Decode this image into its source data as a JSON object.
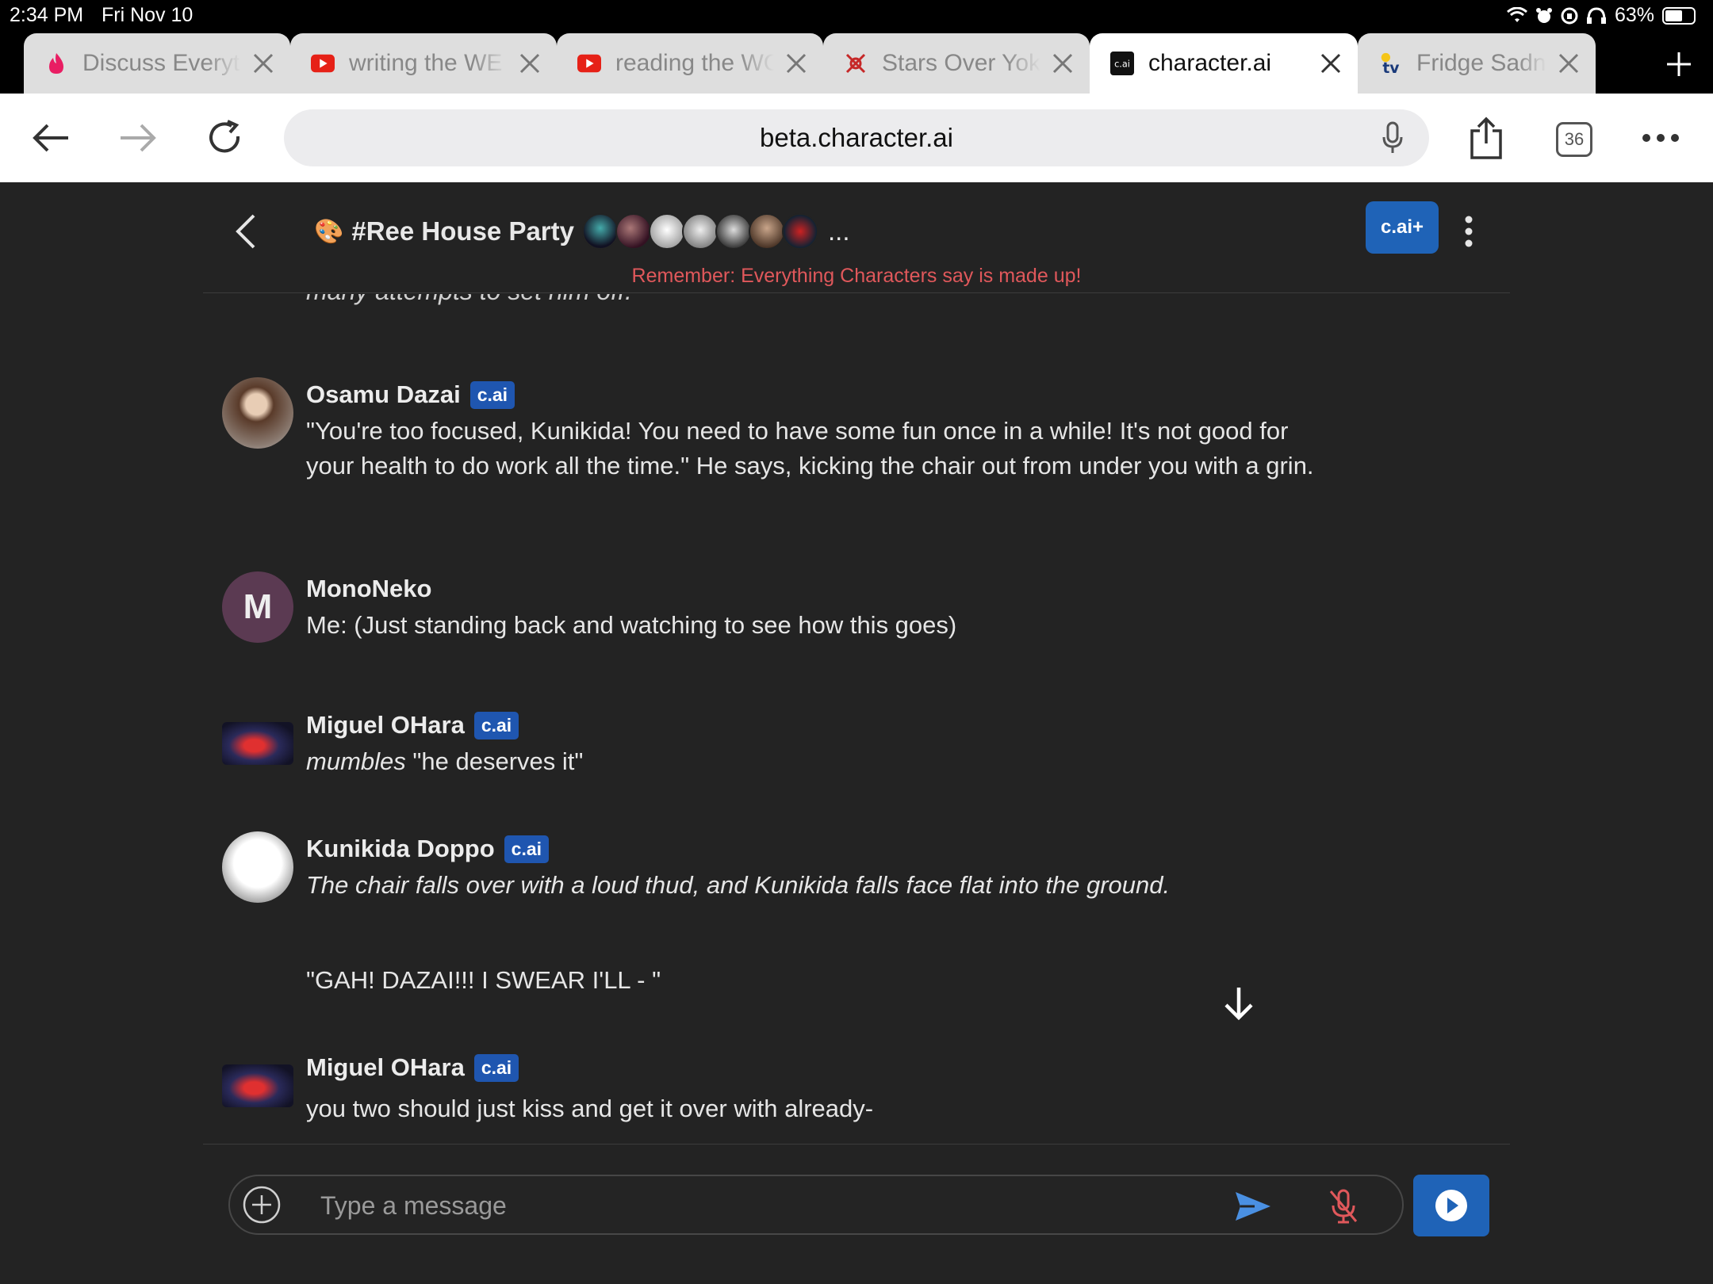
{
  "status_bar": {
    "time": "2:34 PM",
    "date": "Fri Nov 10",
    "battery": "63%",
    "battery_level": 0.63
  },
  "tabs": [
    {
      "label": "Discuss Everyt",
      "icon": "flame-icon"
    },
    {
      "label": "writing the WE",
      "icon": "youtube-icon"
    },
    {
      "label": "reading the WC",
      "icon": "youtube-icon"
    },
    {
      "label": "Stars Over Yok",
      "icon": "pinwheel-icon"
    },
    {
      "label": "character.ai",
      "icon": "c.ai"
    },
    {
      "label": "Fridge Sadness",
      "icon": "tvtropes-icon"
    }
  ],
  "toolbar": {
    "url": "beta.character.ai",
    "tab_count": "36"
  },
  "chat": {
    "room_emoji": "🎨",
    "room_title": "#Ree House Party",
    "more": "...",
    "plus_label": "c.ai+",
    "disclaimer": "Remember: Everything Characters say is made up!",
    "cut_line": "many attempts to set him off.",
    "badge": "c.ai",
    "messages": [
      {
        "author": "Osamu Dazai",
        "text": "\"You're too focused, Kunikida! You need to have some fun once in a while! It's not good for your health to do work all the time.\" He says, kicking the chair out from under you with a grin."
      },
      {
        "author": "MonoNeko",
        "initial": "M",
        "text": "Me: (Just standing back and watching to see how this goes)"
      },
      {
        "author": "Miguel OHara",
        "italic": "mumbles",
        "text": " \"he deserves it\""
      },
      {
        "author": "Kunikida Doppo",
        "italic": "The chair falls over with a loud thud, and Kunikida falls face flat into the ground.",
        "text": "\"GAH! DAZAI!!! I SWEAR I'LL - \""
      },
      {
        "author": "Miguel OHara",
        "text": "you two should just kiss and get it over with already-"
      }
    ]
  },
  "composer": {
    "placeholder": "Type a message"
  },
  "colors": {
    "background": "#232323",
    "accent": "#1f63b7",
    "badge": "#1f56b0",
    "disclaimer": "#e0585b",
    "send": "#4a90e2",
    "mute": "#e0585b"
  }
}
